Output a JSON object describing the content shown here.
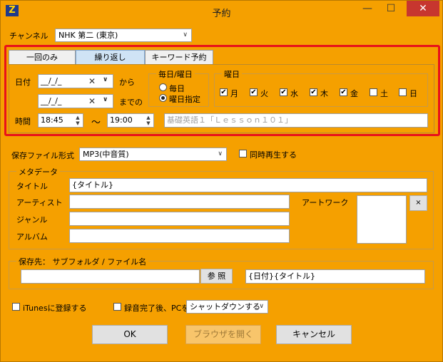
{
  "window": {
    "title": "予約",
    "app_icon": "Z",
    "minimize": "—",
    "maximize": "☐",
    "close": "✕"
  },
  "channel": {
    "label": "チャンネル",
    "value": "NHK 第二 (東京)"
  },
  "tabs": [
    {
      "label": "一回のみ"
    },
    {
      "label": "繰り返し"
    },
    {
      "label": "キーワード予約"
    }
  ],
  "schedule": {
    "date_label": "日付",
    "date_from_value": "__/_/_",
    "date_from_suffix": "から",
    "date_to_value": "__/_/_",
    "date_to_suffix": "までの",
    "time_label": "時間",
    "time_from": "18:45",
    "time_sep": "～",
    "time_to": "19:00",
    "program_placeholder": "基礎英語１「Ｌｅｓｓｏｎ１０１」"
  },
  "repeat": {
    "title": "毎日/曜日",
    "daily": "毎日",
    "weekday": "曜日指定"
  },
  "weekdays": {
    "title": "曜日",
    "days": [
      {
        "label": "月",
        "checked": "✔"
      },
      {
        "label": "火",
        "checked": "✔"
      },
      {
        "label": "水",
        "checked": "✔"
      },
      {
        "label": "木",
        "checked": "✔"
      },
      {
        "label": "金",
        "checked": "✔"
      },
      {
        "label": "土",
        "checked": ""
      },
      {
        "label": "日",
        "checked": ""
      }
    ]
  },
  "format": {
    "label": "保存ファイル形式",
    "value": "MP3(中音質)",
    "simul_play": "同時再生する"
  },
  "metadata": {
    "title": "メタデータ",
    "title_label": "タイトル",
    "title_value": "{タイトル}",
    "artist_label": "アーティスト",
    "artist_value": "",
    "genre_label": "ジャンル",
    "genre_value": "",
    "album_label": "アルバム",
    "album_value": "",
    "artwork_label": "アートワーク",
    "artwork_clear": "×"
  },
  "save": {
    "title": "保存先： サブフォルダ / ファイル名",
    "folder_value": "",
    "browse": "参 照",
    "filename_value": "{日付}{タイトル}"
  },
  "options": {
    "itunes": "iTunesに登録する",
    "after_rec": "録音完了後、PCを",
    "after_action": "シャットダウンする"
  },
  "buttons": {
    "ok": "OK",
    "browser": "ブラウザを開く",
    "cancel": "キャンセル"
  },
  "colors": {
    "background": "#f5a000",
    "highlight": "#e8111b",
    "tab_active": "#cfe3f5"
  }
}
